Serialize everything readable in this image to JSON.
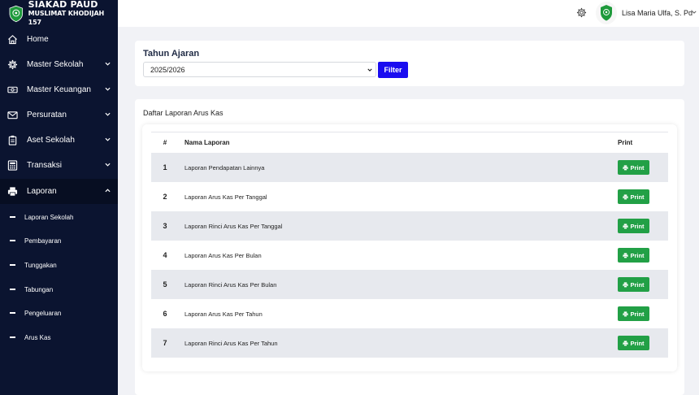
{
  "brand": {
    "title_line1": "SIAKAD PAUD",
    "title_line2": "MUSLIMAT KHODIJAH 157"
  },
  "sidebar": {
    "items": [
      {
        "label": "Home",
        "icon": "home-icon"
      },
      {
        "label": "Master Sekolah",
        "icon": "gear-icon"
      },
      {
        "label": "Master Keuangan",
        "icon": "money-icon"
      },
      {
        "label": "Persuratan",
        "icon": "envelope-icon"
      },
      {
        "label": "Aset Sekolah",
        "icon": "clipboard-icon"
      },
      {
        "label": "Transaksi",
        "icon": "calculator-icon"
      },
      {
        "label": "Laporan",
        "icon": "printer-icon"
      }
    ],
    "subitems": [
      {
        "label": "Laporan Sekolah"
      },
      {
        "label": "Pembayaran"
      },
      {
        "label": "Tunggakan"
      },
      {
        "label": "Tabungan"
      },
      {
        "label": "Pengeluaran"
      },
      {
        "label": "Arus Kas"
      }
    ]
  },
  "topbar": {
    "username": "Lisa Maria Ulfa, S. Pd"
  },
  "filter": {
    "title": "Tahun Ajaran",
    "selected": "2025/2026",
    "button": "Filter"
  },
  "list": {
    "title": "Daftar Laporan Arus Kas",
    "headers": {
      "no": "#",
      "name": "Nama Laporan",
      "print": "Print"
    },
    "rows": [
      {
        "no": "1",
        "name": "Laporan Pendapatan Lainnya",
        "action": "Print"
      },
      {
        "no": "2",
        "name": "Laporan Arus Kas Per Tanggal",
        "action": "Print"
      },
      {
        "no": "3",
        "name": "Laporan Rinci Arus Kas Per Tanggal",
        "action": "Print"
      },
      {
        "no": "4",
        "name": "Laporan Arus Kas Per Bulan",
        "action": "Print"
      },
      {
        "no": "5",
        "name": "Laporan Rinci Arus Kas Per Bulan",
        "action": "Print"
      },
      {
        "no": "6",
        "name": "Laporan Arus Kas Per Tahun",
        "action": "Print"
      },
      {
        "no": "7",
        "name": "Laporan Rinci Arus Kas Per Tahun",
        "action": "Print"
      }
    ]
  },
  "colors": {
    "sidebar_bg": "#0b1430",
    "filter_btn": "#1a0cf0",
    "print_btn": "#22a046",
    "stripe": "#e7e9ee"
  }
}
